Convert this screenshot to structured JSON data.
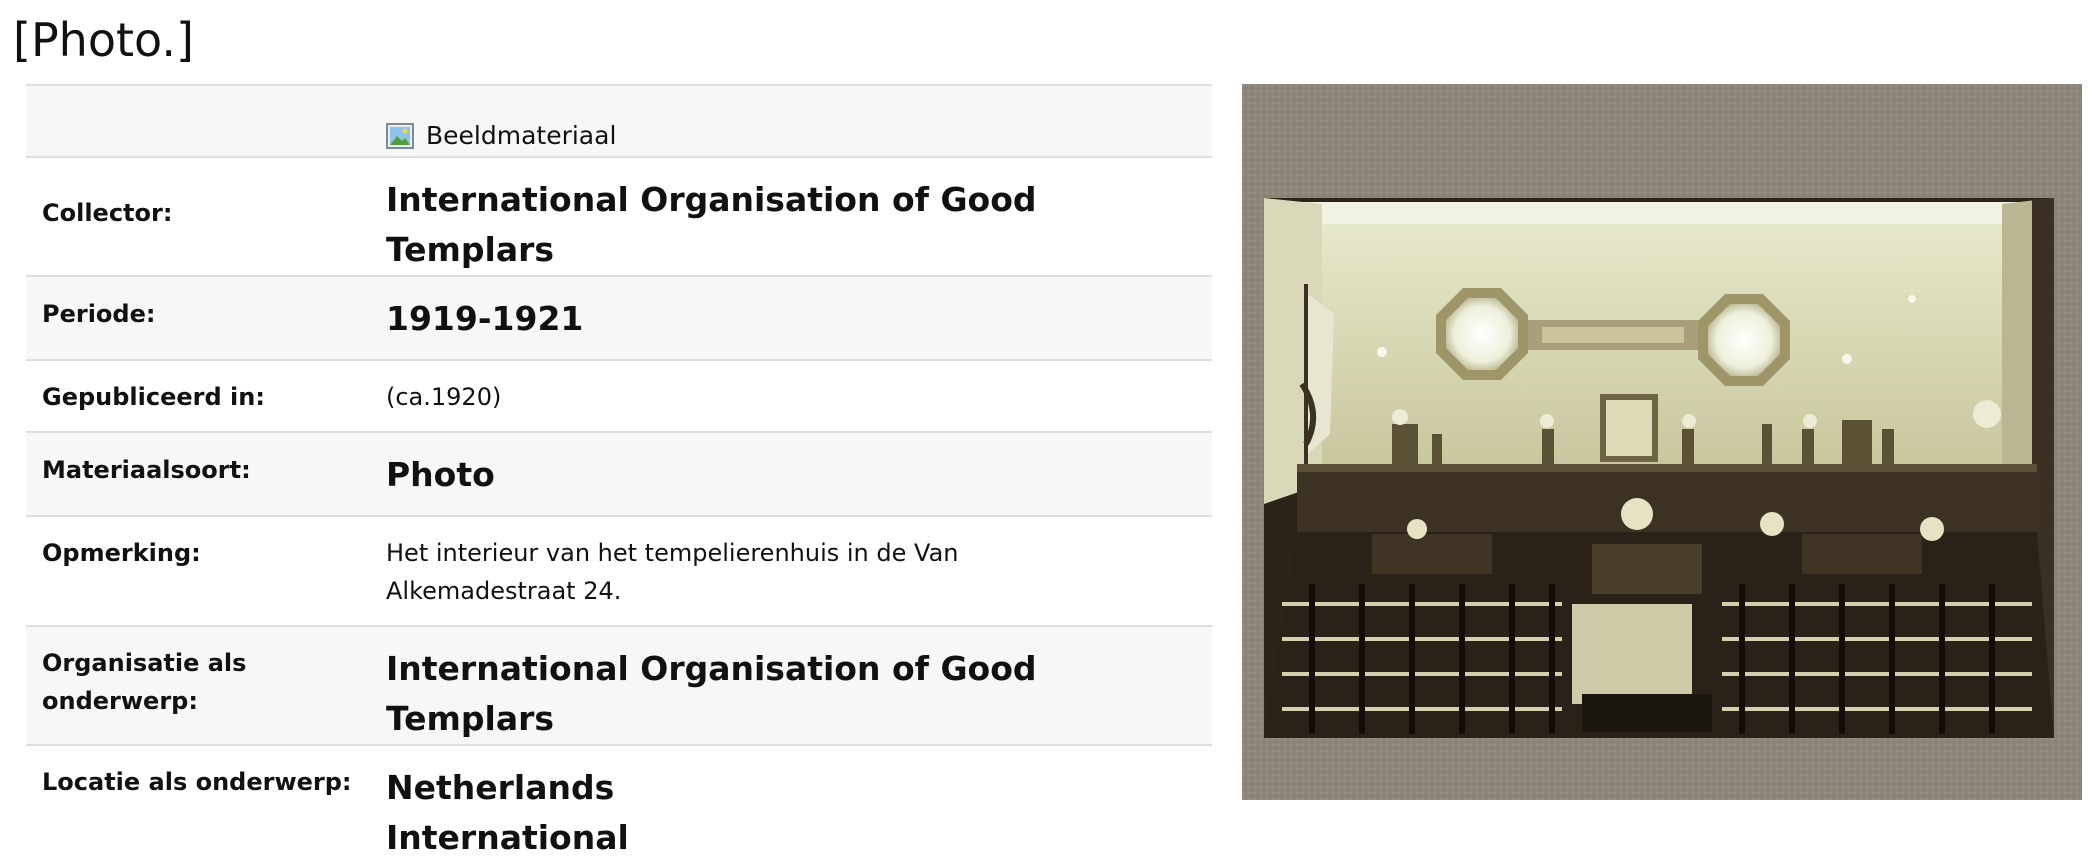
{
  "page": {
    "title": "[Photo.]"
  },
  "record": {
    "type_icon": "image-icon",
    "type_label": "Beeldmateriaal",
    "fields": {
      "collector": {
        "label": "Collector:",
        "value": "International Organisation of Good Templars"
      },
      "periode": {
        "label": "Periode:",
        "value": "1919-1921"
      },
      "gepubliceerd": {
        "label": "Gepubliceerd in:",
        "value": "(ca.1920)"
      },
      "materiaalsoort": {
        "label": "Materiaalsoort:",
        "value": "Photo"
      },
      "opmerking": {
        "label": "Opmerking:",
        "line1": "Het interieur van het tempelierenhuis in de Van",
        "line2": "Alkemadestraat 24."
      },
      "organisatie": {
        "label_line1": "Organisatie als",
        "label_line2": "onderwerp:",
        "value": "International Organisation of Good Templars"
      },
      "locatie": {
        "label": "Locatie als onderwerp:",
        "values": [
          "Netherlands",
          "International"
        ]
      }
    }
  },
  "photo": {
    "subject": "interior of a meeting hall with rows of chairs, two octagonal windows and a flag"
  },
  "colors": {
    "row_shade": "#f7f7f7",
    "divider": "#dedede",
    "text": "#111111"
  }
}
